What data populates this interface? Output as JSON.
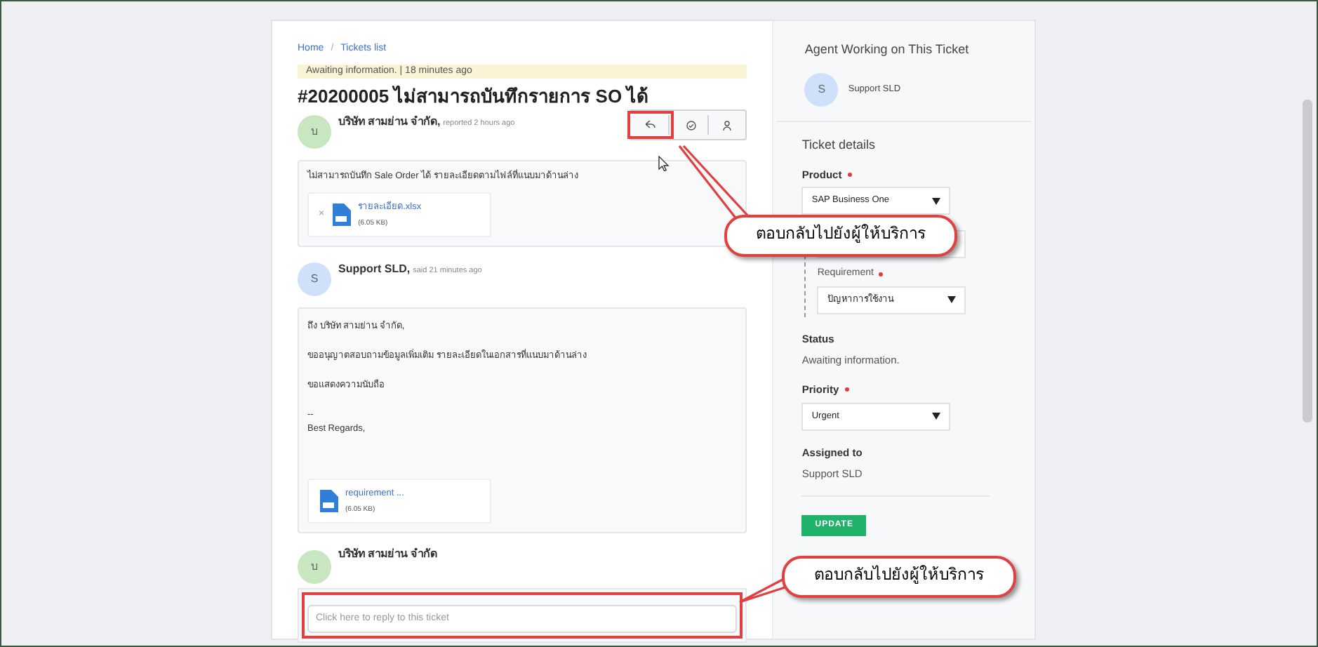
{
  "breadcrumb": [
    {
      "label": "Home"
    },
    {
      "label": "Tickets list"
    }
  ],
  "breadcrumb_separator": "/",
  "status_banner": "Awaiting information. | 18 minutes ago",
  "ticket_title": "#20200005 ไม่สามารถบันทึกรายการ SO ได้",
  "messages": [
    {
      "author": "บริษัท สามย่าน จำกัด,",
      "meta": "reported 2 hours ago",
      "avatar": "บ",
      "color": "#c8e6c0",
      "paragraphs": [
        "ไม่สามารถบันทึก Sale Order ได้ รายละเอียดตามไฟล์ที่แนบมาด้านล่าง"
      ],
      "attachment": {
        "name": "รายละเอียด.xlsx",
        "size": "(6.05 KB)",
        "remove": "×"
      }
    },
    {
      "author": "Support SLD,",
      "meta": "said 21 minutes ago",
      "avatar": "S",
      "color": "#cfe0fb",
      "paragraphs": [
        "ถึง บริษัท สามย่าน จำกัด,",
        "ขออนุญาตสอบถามข้อมูลเพิ่มเติม รายละเอียดในเอกสารที่แนบมาด้านล่าง",
        "ขอแสดงความนับถือ",
        "--\nBest Regards,"
      ],
      "attachment": {
        "name": "requirement ...",
        "size": "(6.05 KB)"
      }
    }
  ],
  "reply": {
    "author": "บริษัท สามย่าน จำกัด",
    "avatar": "บ",
    "color": "#c8e6c0",
    "placeholder": "Click here to reply to this ticket"
  },
  "sidebar": {
    "agent_heading": "Agent Working on This Ticket",
    "agent": {
      "avatar": "S",
      "name": "Support SLD"
    },
    "details_heading": "Ticket details",
    "fields": [
      {
        "kind": "select",
        "label": "Product",
        "required": true,
        "value": "SAP Business One",
        "children": [
          {
            "kind": "select"
          },
          {
            "kind": "select",
            "label": "Requirement",
            "required": true,
            "value": "ปัญหาการใช้งาน"
          }
        ]
      },
      {
        "kind": "text",
        "label": "Status",
        "value": "Awaiting information."
      },
      {
        "kind": "select",
        "label": "Priority",
        "required": true,
        "value": "Urgent"
      },
      {
        "kind": "text",
        "label": "Assigned to",
        "value": "Support SLD"
      }
    ],
    "button": "UPDATE"
  },
  "callouts": [
    {
      "text": "ตอบกลับไปยังผู้ให้บริการ"
    },
    {
      "text": "ตอบกลับไปยังผู้ให้บริการ"
    }
  ]
}
